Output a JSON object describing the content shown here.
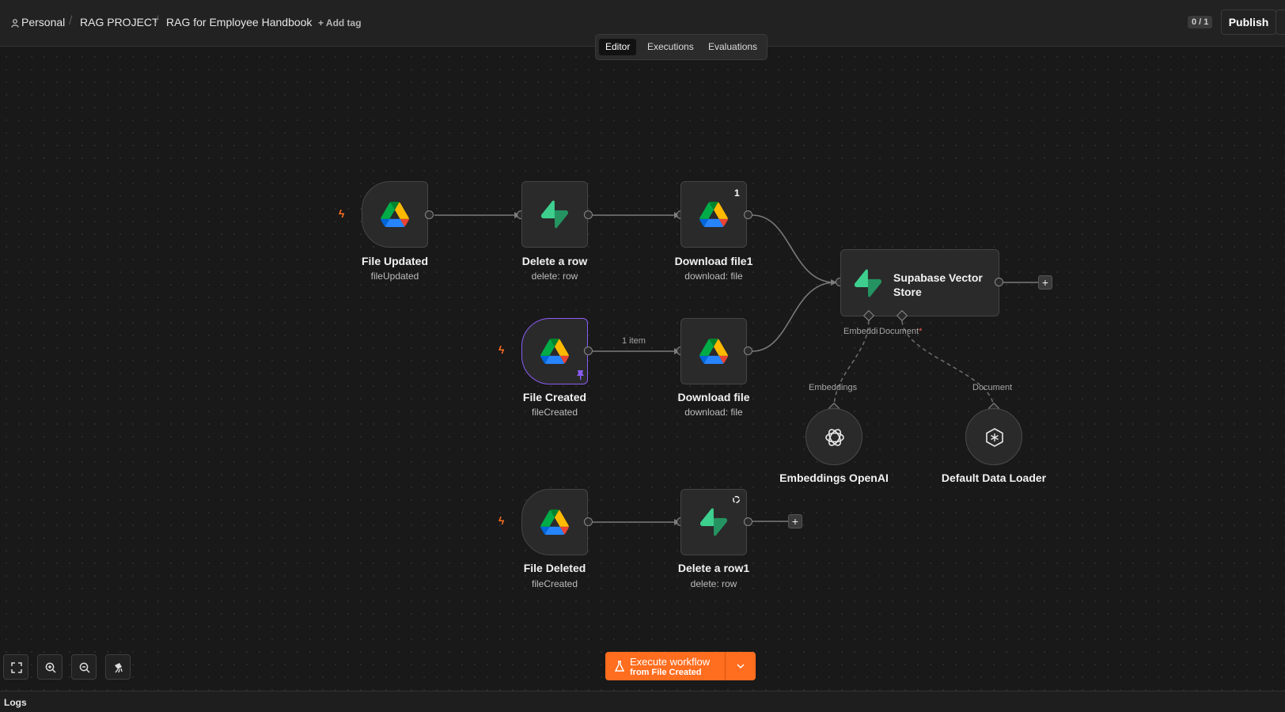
{
  "header": {
    "breadcrumb_personal": "Personal",
    "breadcrumb_project": "RAG PROJECT",
    "workflow_name": "RAG for Employee Handbook",
    "add_tag": "+ Add tag",
    "counter": "0 / 1",
    "publish": "Publish"
  },
  "tabs": {
    "editor": "Editor",
    "executions": "Executions",
    "evaluations": "Evaluations"
  },
  "nodes": {
    "file_updated": {
      "title": "File Updated",
      "sub": "fileUpdated"
    },
    "delete_a_row": {
      "title": "Delete a row",
      "sub": "delete: row"
    },
    "download_file1": {
      "title": "Download file1",
      "sub": "download: file",
      "badge": "1"
    },
    "file_created": {
      "title": "File Created",
      "sub": "fileCreated"
    },
    "download_file": {
      "title": "Download file",
      "sub": "download: file"
    },
    "file_deleted": {
      "title": "File Deleted",
      "sub": "fileCreated"
    },
    "delete_a_row1": {
      "title": "Delete a row1",
      "sub": "delete: row"
    },
    "supabase": {
      "title": "Supabase Vector Store",
      "port_embeddings": "Embeddi",
      "port_document": "Document",
      "required_mark": "*"
    },
    "embeddings_openai": {
      "title": "Embeddings OpenAI",
      "conn_label": "Embeddings"
    },
    "default_data_loader": {
      "title": "Default Data Loader",
      "conn_label": "Document"
    }
  },
  "edges": {
    "one_item": "1 item"
  },
  "execute": {
    "main": "Execute workflow",
    "sub": "from File Created"
  },
  "logs": "Logs",
  "colors": {
    "accent": "#ff6d1f",
    "selected": "#8a5cf6",
    "supabase_green": "#3ecf8e"
  },
  "icons": [
    "person-icon",
    "google-drive-icon",
    "supabase-icon",
    "openai-icon",
    "data-loader-icon",
    "fit-view-icon",
    "zoom-in-icon",
    "zoom-out-icon",
    "tidy-icon",
    "flask-icon",
    "pin-icon",
    "refresh-icon",
    "bolt-icon"
  ]
}
